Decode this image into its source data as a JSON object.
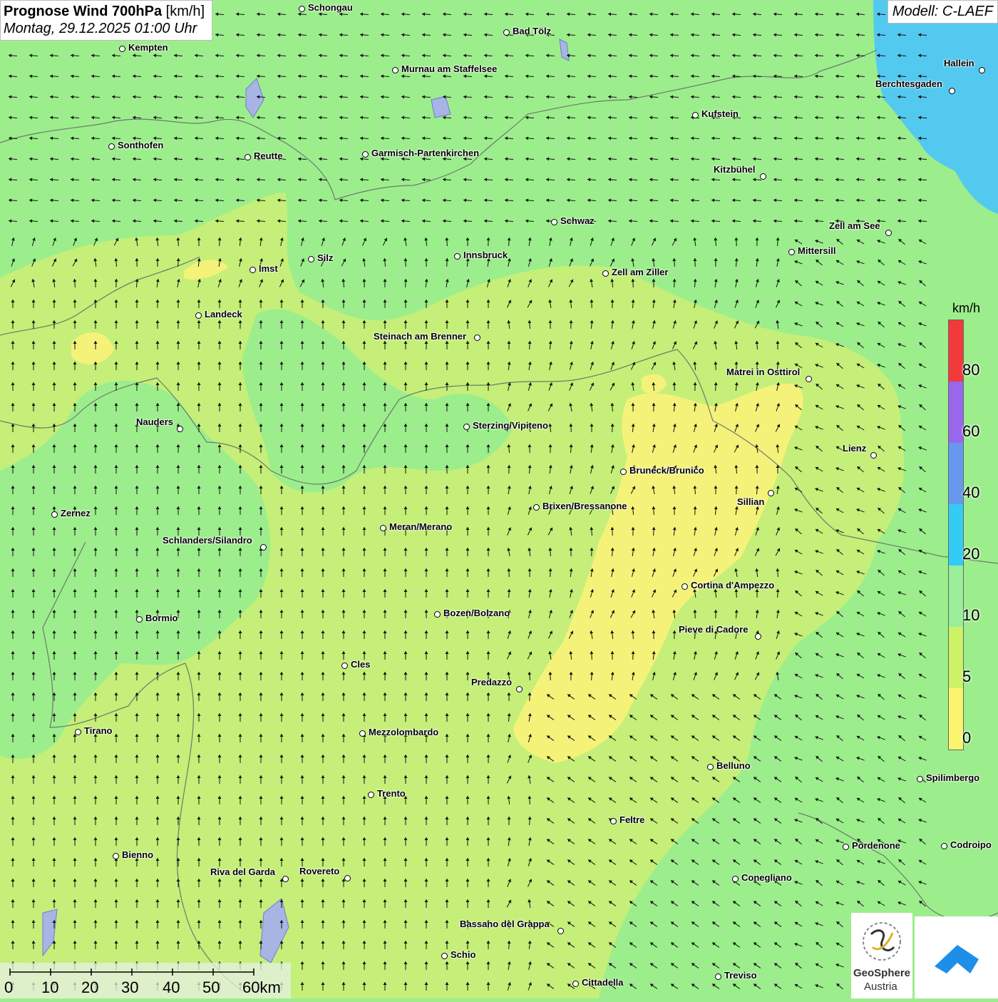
{
  "header": {
    "title": "Prognose Wind 700hPa",
    "unit": "[km/h]",
    "datetime": "Montag, 29.12.2025 01:00 Uhr"
  },
  "model_label": "Modell: C-LAEF",
  "legend": {
    "unit": "km/h",
    "ticks": [
      "80",
      "60",
      "40",
      "20",
      "10",
      "5",
      "0"
    ],
    "colors": [
      "#f23a3a",
      "#9966ee",
      "#6699ee",
      "#33ccf5",
      "#99ee99",
      "#ccf266",
      "#fbf56e"
    ]
  },
  "cities": [
    {
      "name": "Schongau"
    },
    {
      "name": "Bad Tölz"
    },
    {
      "name": "Kempten"
    },
    {
      "name": "Murnau am Staffelsee"
    },
    {
      "name": "Hallein"
    },
    {
      "name": "Berchtesgaden"
    },
    {
      "name": "Kufstein"
    },
    {
      "name": "Sonthofen"
    },
    {
      "name": "Reutte"
    },
    {
      "name": "Garmisch-Partenkirchen"
    },
    {
      "name": "Kitzbühel"
    },
    {
      "name": "Schwaz"
    },
    {
      "name": "Zell am See"
    },
    {
      "name": "Mittersill"
    },
    {
      "name": "Silz"
    },
    {
      "name": "Innsbruck"
    },
    {
      "name": "Imst"
    },
    {
      "name": "Zell am Ziller"
    },
    {
      "name": "Landeck"
    },
    {
      "name": "Steinach am Brenner"
    },
    {
      "name": "Matrei in Osttirol"
    },
    {
      "name": "Nauders"
    },
    {
      "name": "Sterzing/Vipiteno"
    },
    {
      "name": "Lienz"
    },
    {
      "name": "Bruneck/Brunico"
    },
    {
      "name": "Sillian"
    },
    {
      "name": "Zernez"
    },
    {
      "name": "Brixen/Bressanone"
    },
    {
      "name": "Meran/Merano"
    },
    {
      "name": "Schlanders/Silandro"
    },
    {
      "name": "Cortina d'Ampezzo"
    },
    {
      "name": "Bozen/Bolzano"
    },
    {
      "name": "Bormio"
    },
    {
      "name": "Pieve di Cadore"
    },
    {
      "name": "Cles"
    },
    {
      "name": "Predazzo"
    },
    {
      "name": "Tirano"
    },
    {
      "name": "Mezzolombardo"
    },
    {
      "name": "Belluno"
    },
    {
      "name": "Spilimbergo"
    },
    {
      "name": "Trento"
    },
    {
      "name": "Feltre"
    },
    {
      "name": "Bienno"
    },
    {
      "name": "Pordenone"
    },
    {
      "name": "Codroipo"
    },
    {
      "name": "Riva del Garda"
    },
    {
      "name": "Rovereto"
    },
    {
      "name": "Conegliano"
    },
    {
      "name": "Bassano del Grappa"
    },
    {
      "name": "Schio"
    },
    {
      "name": "Treviso"
    },
    {
      "name": "Cittadella"
    }
  ],
  "scale_bar": {
    "labels": [
      "0",
      "10",
      "20",
      "30",
      "40",
      "50",
      "60km"
    ]
  },
  "logo": {
    "line1": "GeoSphere",
    "line2": "Austria"
  },
  "colors": {
    "yellow": "#fbf56e",
    "yellow_green": "#ccf266",
    "light_green": "#9cee8c",
    "blue": "#33ccf5"
  }
}
